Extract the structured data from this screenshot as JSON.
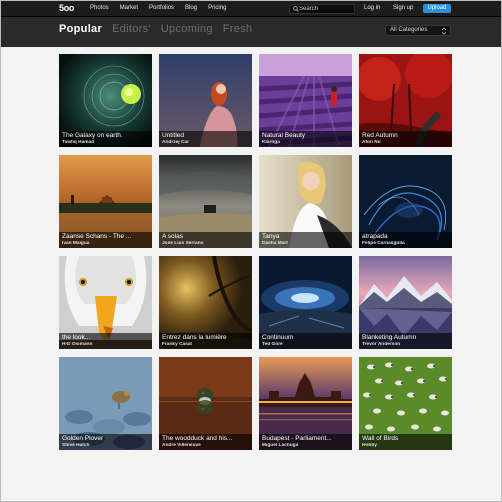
{
  "header": {
    "logo": "5oo",
    "nav": [
      "Photos",
      "Market",
      "Portfolios",
      "Blog",
      "Pricing"
    ],
    "search_placeholder": "Search",
    "login": "Log in",
    "signup": "Sign up",
    "upload": "Upload"
  },
  "subnav": {
    "tabs": [
      "Popular",
      "Editors'",
      "Upcoming",
      "Fresh"
    ],
    "active_tab": "Popular",
    "category": "All Categories"
  },
  "photos": [
    {
      "title": "The Galaxy on earth.",
      "author": "Tawfiq Hamad"
    },
    {
      "title": "Untitled",
      "author": "Andrzej Car"
    },
    {
      "title": "Natural Beauty",
      "author": "Klarnga"
    },
    {
      "title": "Red Autumn",
      "author": "Afon No"
    },
    {
      "title": "Zaanse Schans - The ...",
      "author": "Iván Maigua"
    },
    {
      "title": "A solas",
      "author": "Jose Luis Serrano"
    },
    {
      "title": "Tanya",
      "author": "Dasha Mart"
    },
    {
      "title": "atrapada",
      "author": "Felipe Carnasgulla"
    },
    {
      "title": "the look...",
      "author": "H-D Osimann"
    },
    {
      "title": "Entrez dans la lumière",
      "author": "Franky Casal"
    },
    {
      "title": "Continuum",
      "author": "Ted Gore"
    },
    {
      "title": "Blanketing Autumn",
      "author": "Trevor Anderson"
    },
    {
      "title": "Golden Plover",
      "author": "Steve Hatch"
    },
    {
      "title": "The woodduck and his...",
      "author": "Andre Villeneuve"
    },
    {
      "title": "Budapest - Parliament...",
      "author": "Miguel Lachuga"
    },
    {
      "title": "Wall of Birds",
      "author": "Hobby"
    }
  ],
  "colors": {
    "topbar": "#1c1c1c",
    "subbar": "#2a2a2a",
    "accent": "#2b8ed9",
    "page_bg": "#f3f3f3"
  }
}
